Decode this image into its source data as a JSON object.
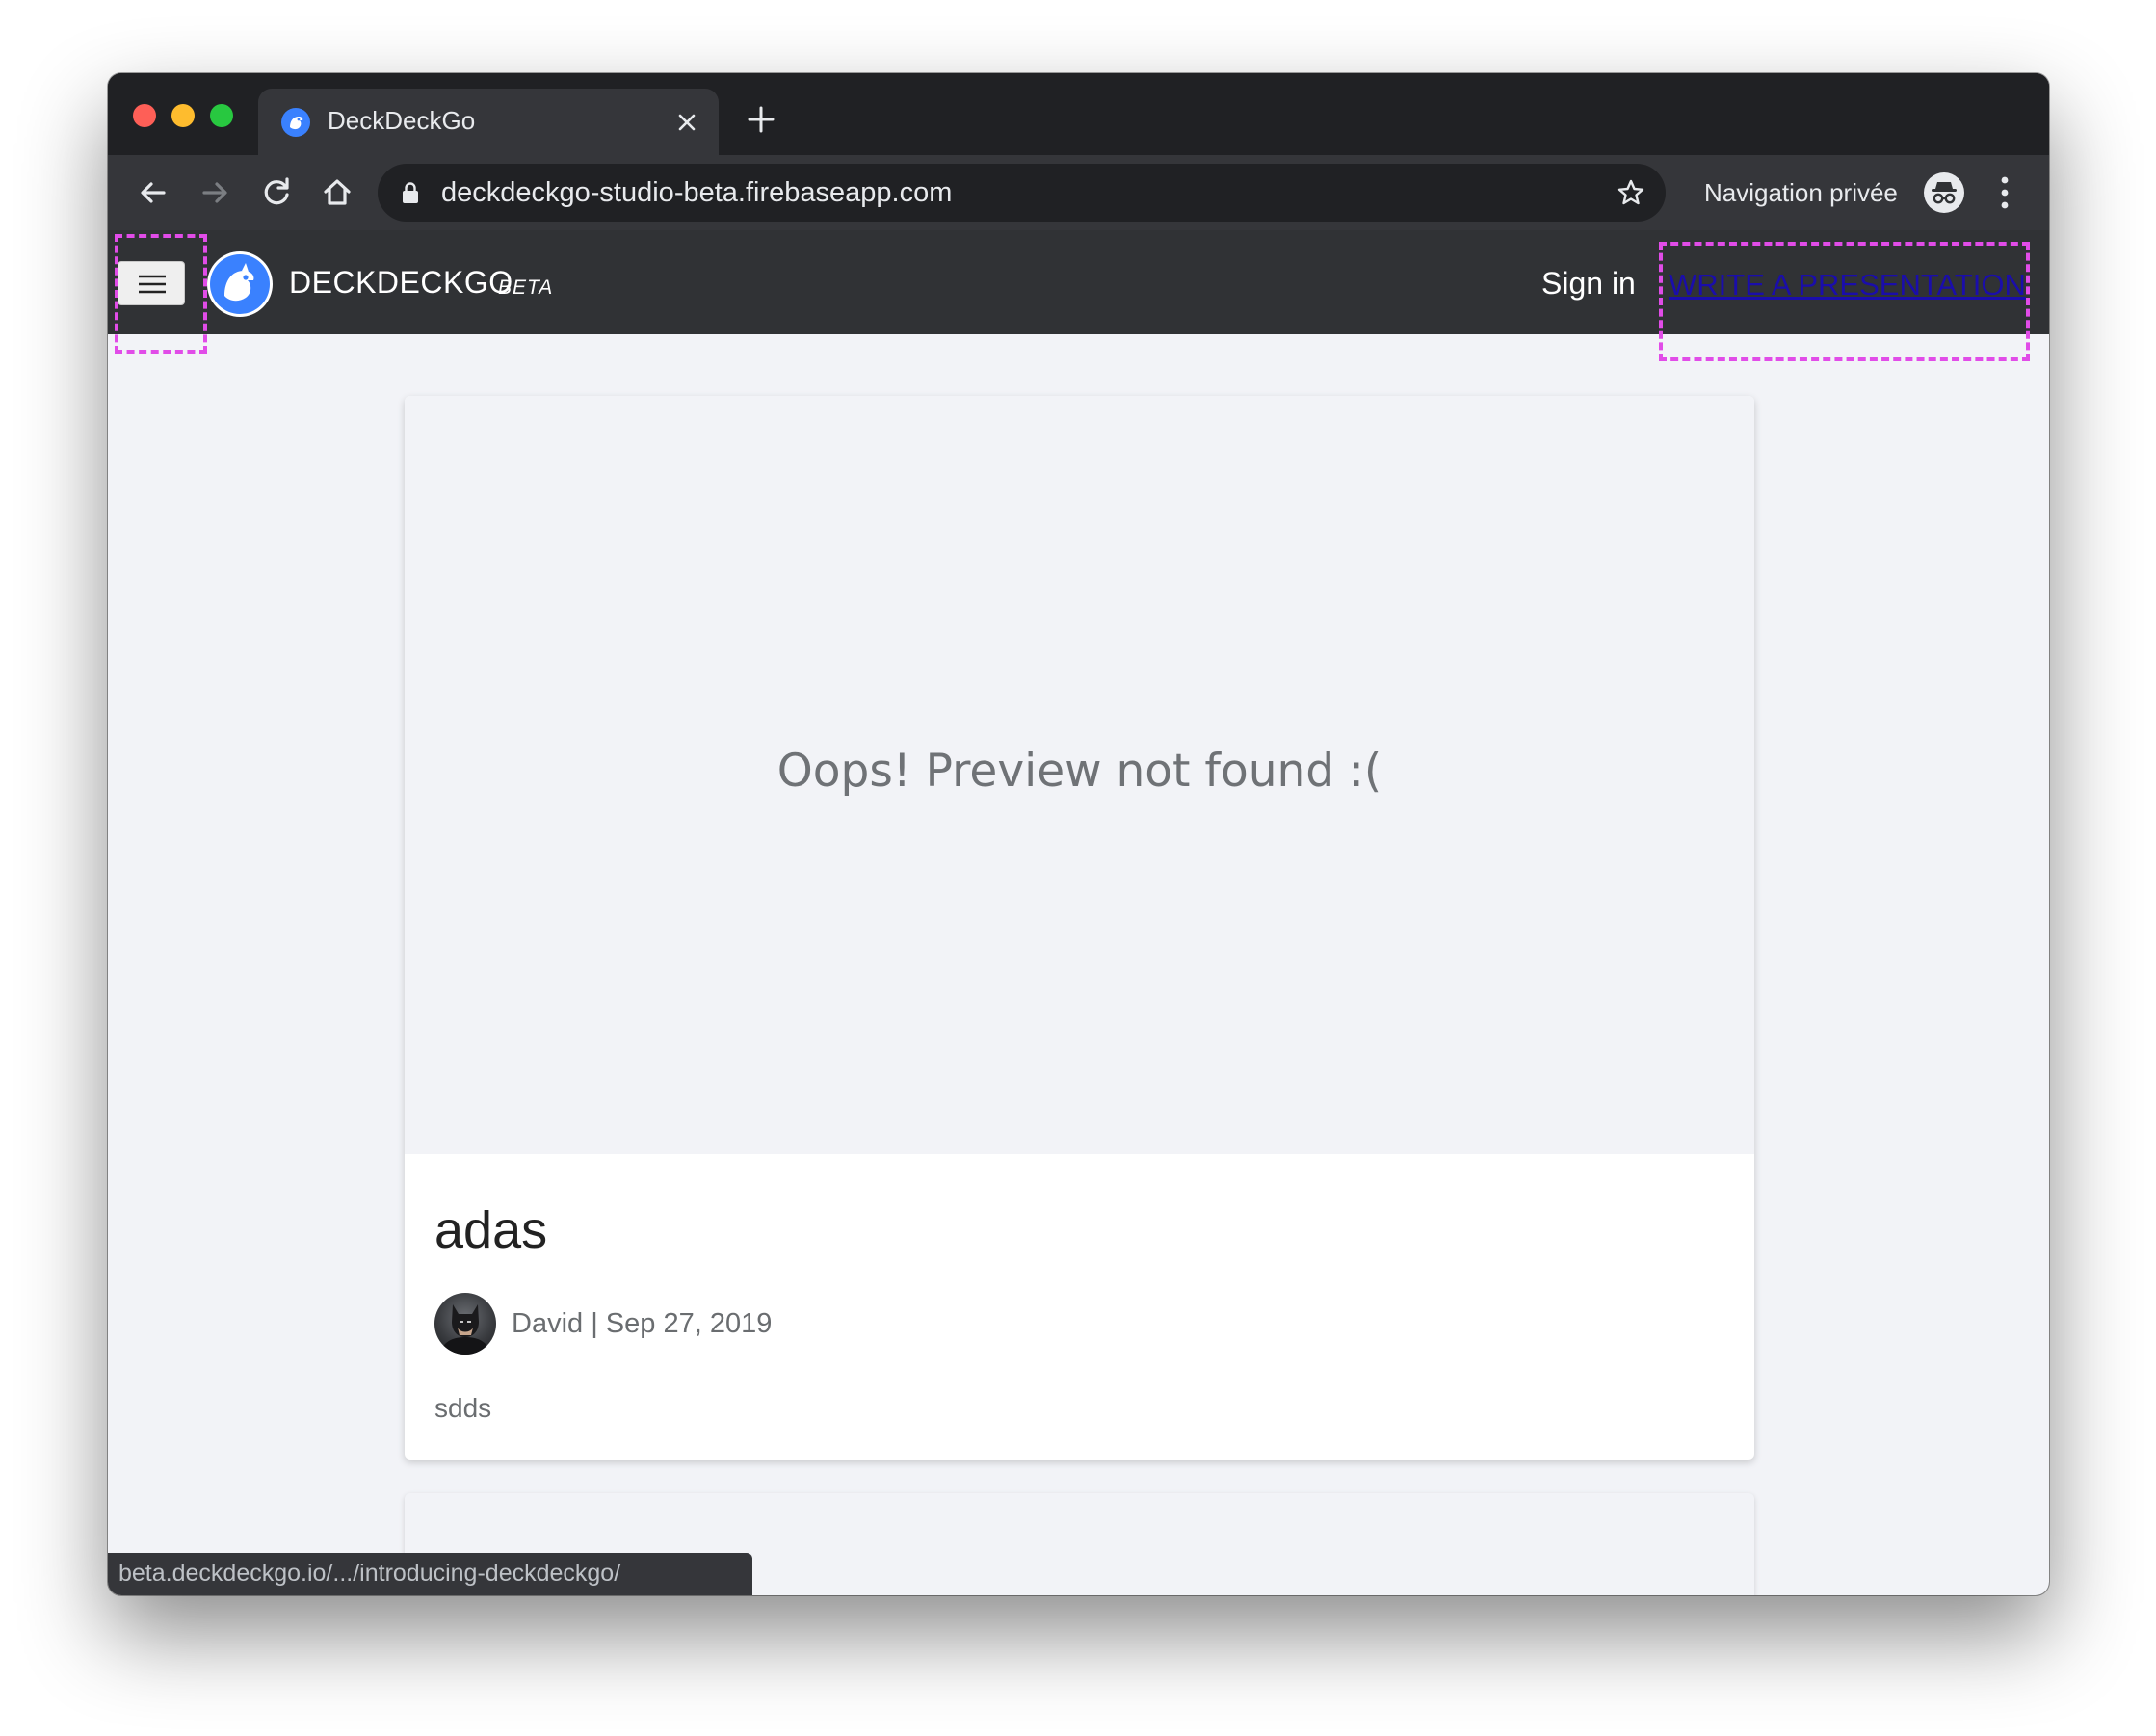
{
  "browser": {
    "tab": {
      "title": "DeckDeckGo"
    },
    "address_bar": {
      "url": "deckdeckgo-studio-beta.firebaseapp.com"
    },
    "profile": {
      "label": "Navigation privée"
    },
    "status_bubble": {
      "url": "beta.deckdeckgo.io/.../introducing-deckdeckgo/"
    }
  },
  "app_header": {
    "name": "DECKDECKGO",
    "badge": "BETA",
    "signin_label": "Sign in",
    "write_label": "WRITE A PRESENTATION"
  },
  "feed": {
    "cards": [
      {
        "preview_message": "Oops! Preview not found :(",
        "title": "adas",
        "author": "David",
        "date": "Sep 27, 2019",
        "author_line": "David | Sep 27, 2019",
        "description": "sdds"
      }
    ]
  },
  "colors": {
    "app_bar": "#303235",
    "page_background": "#f2f3f7",
    "highlight_outline": "#e14ce8",
    "link": "#1a0dab"
  }
}
